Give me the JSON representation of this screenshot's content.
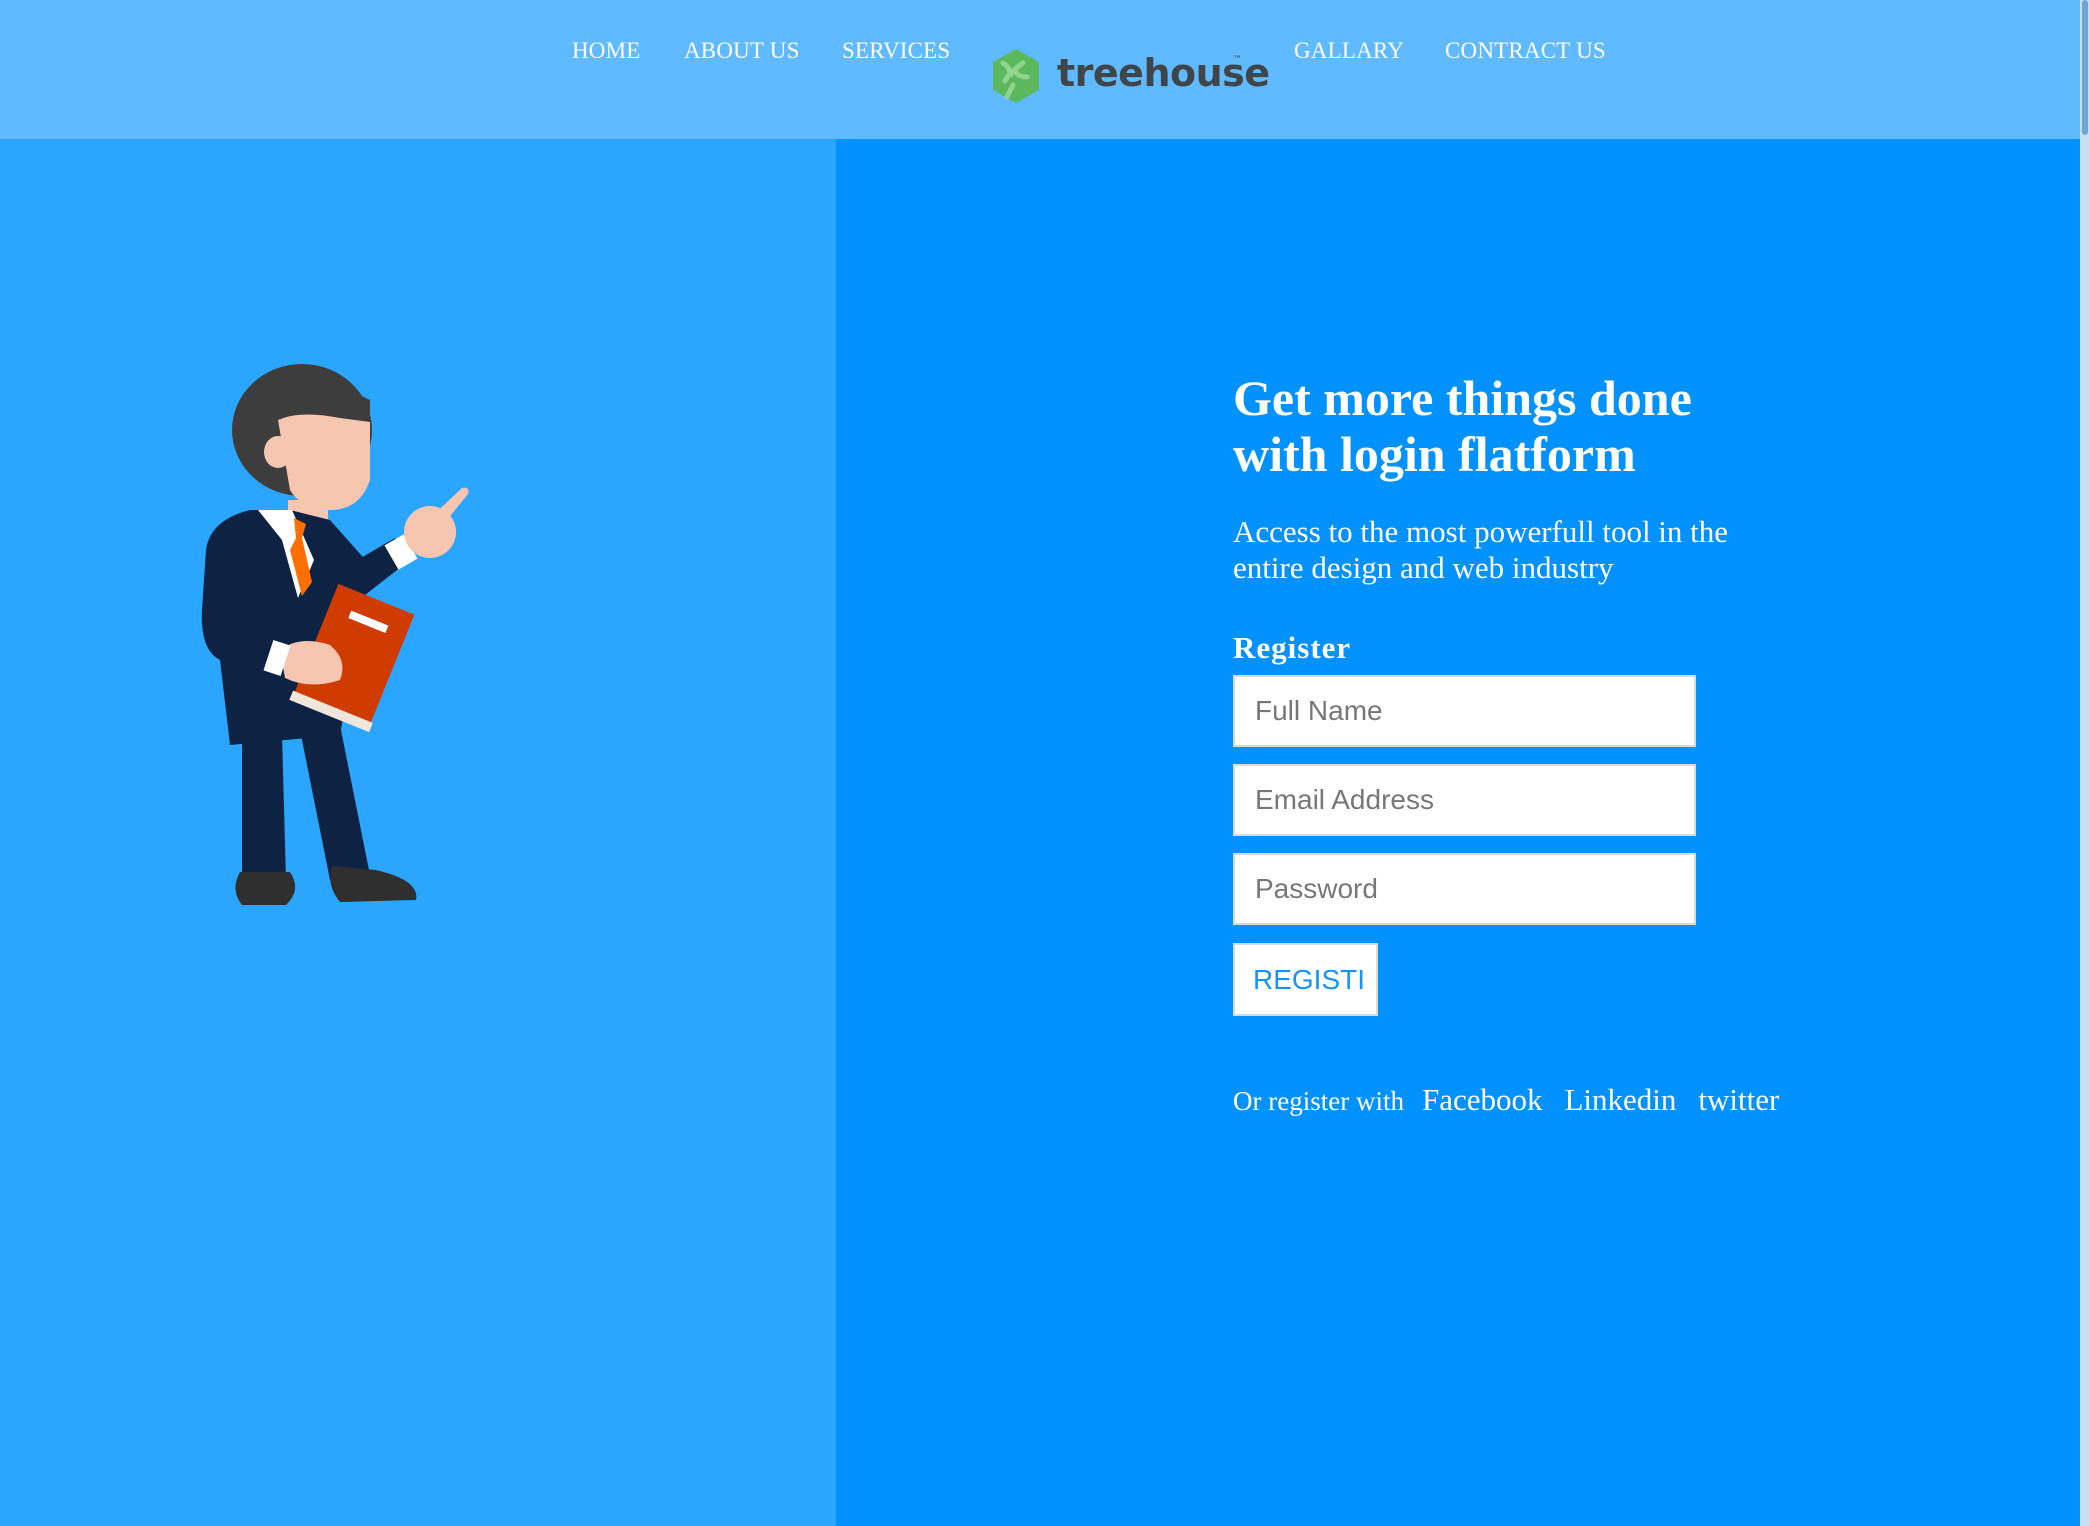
{
  "nav": {
    "items": [
      "HOME",
      "ABOUT US",
      "SERVICES",
      "GALLARY",
      "CONTRACT US"
    ],
    "logo_text": "treehouse",
    "logo_tm": "™"
  },
  "hero": {
    "title": "Get more things done with login flatform",
    "subtitle": "Access to the most powerfull tool in the entire design and web industry"
  },
  "register": {
    "heading": "Register",
    "full_name_placeholder": "Full Name",
    "email_placeholder": "Email Address",
    "password_placeholder": "Password",
    "button_label": "REGISTI"
  },
  "social": {
    "prefix": "Or register with",
    "links": [
      "Facebook",
      "Linkedin",
      "twitter"
    ]
  },
  "colors": {
    "header": "#5fbaff",
    "left_panel": "#2ba6ff",
    "right_panel": "#0192ff",
    "logo_green": "#5cb85c"
  },
  "icons": {
    "logo": "treehouse-logo-icon",
    "illustration": "businessman-illustration"
  }
}
